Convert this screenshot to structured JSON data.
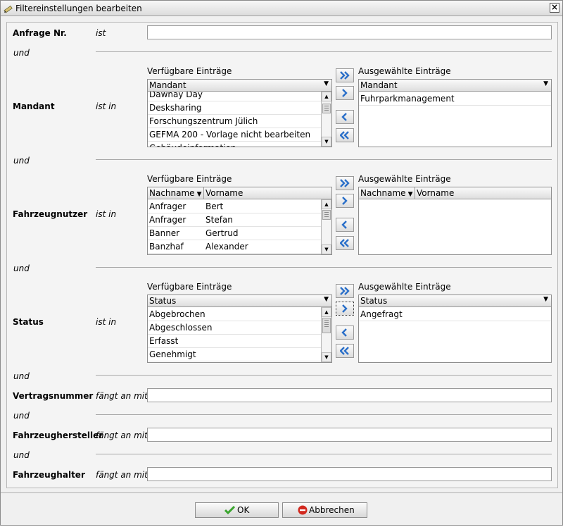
{
  "window": {
    "title": "Filtereinstellungen bearbeiten"
  },
  "conj": "und",
  "fields": {
    "anfrage": {
      "label": "Anfrage Nr.",
      "op": "ist",
      "value": ""
    },
    "mandant": {
      "label": "Mandant",
      "op": "ist in"
    },
    "nutzer": {
      "label": "Fahrzeugnutzer",
      "op": "ist in"
    },
    "status": {
      "label": "Status",
      "op": "ist in"
    },
    "vertrag": {
      "label": "Vertragsnummer",
      "op": "fängt an mit",
      "value": ""
    },
    "hersteller": {
      "label": "Fahrzeughersteller",
      "op": "fängt an mit",
      "value": ""
    },
    "halter": {
      "label": "Fahrzeughalter",
      "op": "fängt an mit",
      "value": ""
    }
  },
  "captions": {
    "available": "Verfügbare Einträge",
    "selected": "Ausgewählte Einträge"
  },
  "mandant_list": {
    "header": "Mandant",
    "available": [
      "Dawnay Day",
      "Desksharing",
      "Forschungszentrum Jülich",
      "GEFMA 200 - Vorlage nicht bearbeiten",
      "Gebäudeinformation"
    ],
    "selected": [
      "Fuhrparkmanagement"
    ]
  },
  "nutzer_list": {
    "col1": "Nachname",
    "col2": "Vorname",
    "available": [
      {
        "nachname": "Anfrager",
        "vorname": "Bert"
      },
      {
        "nachname": "Anfrager",
        "vorname": "Stefan"
      },
      {
        "nachname": "Banner",
        "vorname": "Gertrud"
      },
      {
        "nachname": "Banzhaf",
        "vorname": "Alexander"
      }
    ],
    "selected": []
  },
  "status_list": {
    "header": "Status",
    "available": [
      "Abgebrochen",
      "Abgeschlossen",
      "Erfasst",
      "Genehmigt"
    ],
    "selected": [
      "Angefragt"
    ]
  },
  "buttons": {
    "ok": "OK",
    "cancel": "Abbrechen"
  },
  "colors": {
    "arrow_blue": "#2a6fc9",
    "ok_green": "#3aa52e",
    "cancel_red": "#d2291f"
  }
}
